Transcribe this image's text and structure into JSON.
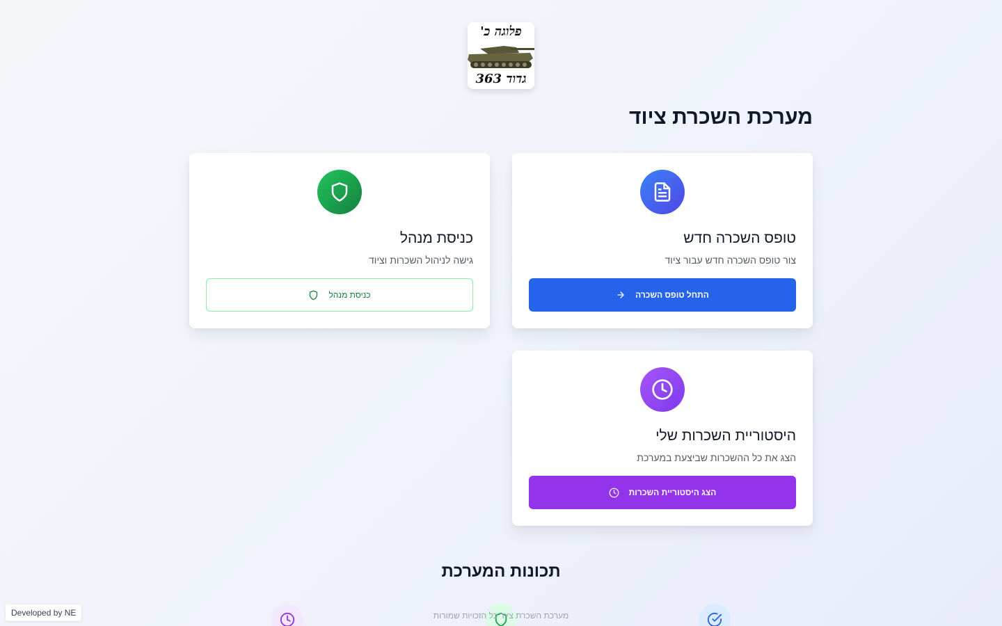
{
  "logo": {
    "top_text": "פלוגה כ'",
    "bottom_text": "גדוד 363"
  },
  "page": {
    "title": "מערכת השכרת ציוד"
  },
  "cards": {
    "new_form": {
      "title": "טופס השכרה חדש",
      "description": "צור טופס השכרה חדש עבור ציוד",
      "button_label": "התחל טופס השכרה",
      "icon": "file-text-icon",
      "color": "#2563eb"
    },
    "admin": {
      "title": "כניסת מנהל",
      "description": "גישה לניהול השכרות וציוד",
      "button_label": "כניסת מנהל",
      "icon": "shield-icon",
      "color": "#16a34a"
    },
    "history": {
      "title": "היסטוריית השכרות שלי",
      "description": "הצג את כל ההשכרות שביצעת במערכת",
      "button_label": "הצג היסטוריית השכרות",
      "icon": "clock-icon",
      "color": "#9333ea"
    }
  },
  "features": {
    "title": "תכונות המערכת",
    "text": "מערכת השכרת ציוד כל הזכויות שמורות",
    "icons": [
      "clock-icon",
      "shield-icon",
      "check-circle-icon"
    ]
  },
  "footer": {
    "developer": "Developed by NE"
  }
}
